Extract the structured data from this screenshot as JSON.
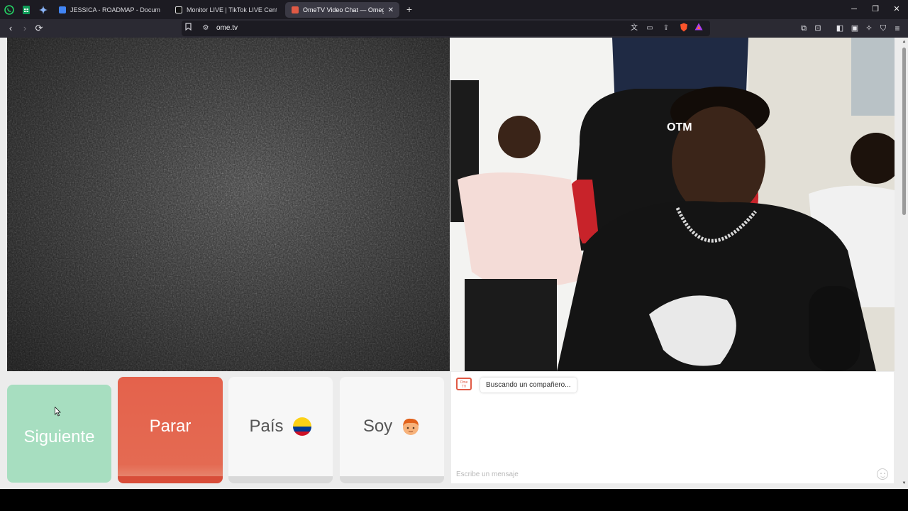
{
  "browser": {
    "tabs": [
      {
        "label": "JESSICA - ROADMAP - Documentos",
        "active": false,
        "favicon_color": "#4285f4"
      },
      {
        "label": "Monitor LIVE | TikTok LIVE Center",
        "active": false,
        "favicon_color": "#111111"
      },
      {
        "label": "OmeTV Video Chat — Omeg",
        "active": true,
        "favicon_color": "#e05a45"
      }
    ],
    "close_tab": "✕",
    "new_tab": "+",
    "url": "ome.tv"
  },
  "controls": {
    "next_label": "Siguiente",
    "stop_label": "Parar",
    "country_label": "País",
    "country_flag": "colombia-flag",
    "gender_label": "Soy",
    "gender_icon": "boy-face-emoji"
  },
  "chat": {
    "logo_text": "Ome TV",
    "status_message": "Buscando un compañero...",
    "input_placeholder": "Escribe un mensaje"
  },
  "colors": {
    "next": "#a7dec0",
    "stop": "#e4624c",
    "neutral_button": "#f7f7f7",
    "brand": "#e05a45"
  }
}
